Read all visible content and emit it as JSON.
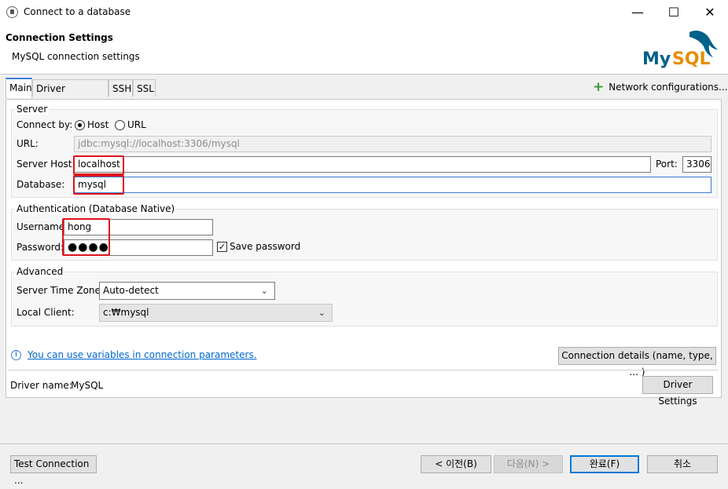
{
  "window": {
    "title": "Connect to a database",
    "minimize_glyph": "—",
    "maximize_glyph": "☐",
    "close_glyph": "✕"
  },
  "header": {
    "title": "Connection Settings",
    "subtitle": "MySQL connection settings",
    "logo_text": "MySQL",
    "logo_colors": {
      "my": "#00618a",
      "sql": "#e48e00"
    }
  },
  "tabs": [
    {
      "label": "Main",
      "active": true
    },
    {
      "label": "Driver properties",
      "active": false
    },
    {
      "label": "SSH",
      "active": false
    },
    {
      "label": "SSL",
      "active": false
    }
  ],
  "network_config": {
    "label": "Network configurations...",
    "icon": "plus-icon"
  },
  "server": {
    "group_label": "Server",
    "connect_by_label": "Connect by:",
    "host_option": "Host",
    "url_option": "URL",
    "selected": "Host",
    "url_label": "URL:",
    "url_value": "jdbc:mysql://localhost:3306/mysql",
    "host_label": "Server Host:",
    "host_value": "localhost",
    "port_label": "Port:",
    "port_value": "3306",
    "database_label": "Database:",
    "database_value": "mysql"
  },
  "auth": {
    "group_label": "Authentication (Database Native)",
    "username_label": "Username:",
    "username_value": "hong",
    "password_label": "Password:",
    "password_value": "●●●●",
    "save_password_label": "Save password",
    "save_password_checked": true
  },
  "advanced": {
    "group_label": "Advanced",
    "timezone_label": "Server Time Zone:",
    "timezone_value": "Auto-detect",
    "client_label": "Local Client:",
    "client_value": "c:₩mysql"
  },
  "info": {
    "text": "You can use variables in connection parameters."
  },
  "connection_details_button": "Connection details (name, type, ... )",
  "driver": {
    "label": "Driver name:",
    "value": "MySQL",
    "settings_button": "Driver Settings"
  },
  "footer": {
    "test_connection": "Test Connection ...",
    "back": "< 이전(B)",
    "next": "다음(N) >",
    "finish": "완료(F)",
    "cancel": "취소"
  },
  "colors": {
    "highlight_red": "#e0131b",
    "accent_blue": "#3b7dd8",
    "plus_green": "#3a9b3a"
  }
}
